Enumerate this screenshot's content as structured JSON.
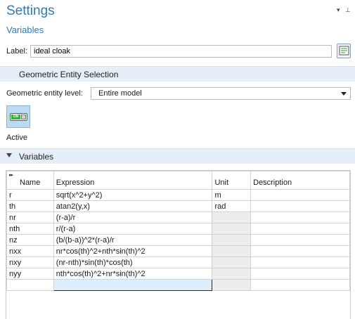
{
  "header": {
    "title": "Settings",
    "subtitle": "Variables",
    "dropdown_glyph": "▾",
    "pin_glyph": "⊥"
  },
  "label_row": {
    "label": "Label:",
    "value": "ideal cloak",
    "button_icon": "edit-label-icon"
  },
  "sections": {
    "geometric": "Geometric Entity Selection",
    "variables": "Variables"
  },
  "geometric": {
    "level_label": "Geometric entity level:",
    "level_value": "Entire model"
  },
  "active": {
    "toggle_text": "ON",
    "label": "Active"
  },
  "table": {
    "columns": [
      "Name",
      "Expression",
      "Unit",
      "Description"
    ],
    "rows": [
      {
        "name": "r",
        "expression": "sqrt(x^2+y^2)",
        "unit": "m",
        "description": ""
      },
      {
        "name": "th",
        "expression": "atan2(y,x)",
        "unit": "rad",
        "description": ""
      },
      {
        "name": "nr",
        "expression": "(r-a)/r",
        "unit": "",
        "description": ""
      },
      {
        "name": "nth",
        "expression": "r/(r-a)",
        "unit": "",
        "description": ""
      },
      {
        "name": "nz",
        "expression": "(b/(b-a))^2*(r-a)/r",
        "unit": "",
        "description": ""
      },
      {
        "name": "nxx",
        "expression": "nr*cos(th)^2+nth*sin(th)^2",
        "unit": "",
        "description": ""
      },
      {
        "name": "nxy",
        "expression": "(nr-nth)*sin(th)*cos(th)",
        "unit": "",
        "description": ""
      },
      {
        "name": "nyy",
        "expression": "nth*cos(th)^2+nr*sin(th)^2",
        "unit": "",
        "description": ""
      }
    ]
  }
}
